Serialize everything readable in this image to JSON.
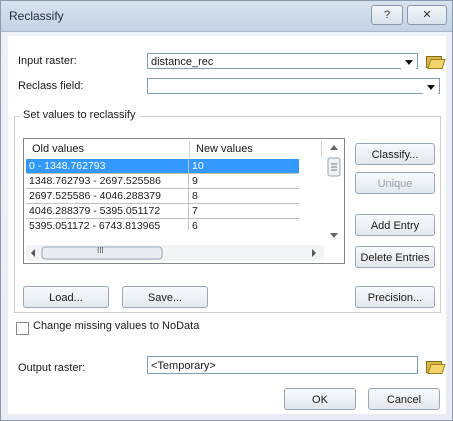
{
  "window": {
    "title": "Reclassify",
    "help_label": "?",
    "close_label": "✕"
  },
  "input_raster": {
    "label": "Input raster:",
    "value": "distance_rec"
  },
  "reclass_field": {
    "label": "Reclass field:",
    "value": ""
  },
  "group": {
    "label": "Set values to reclassify"
  },
  "table": {
    "headers": [
      "Old values",
      "New values"
    ],
    "rows": [
      {
        "old": "0 - 1348.762793",
        "new": "10"
      },
      {
        "old": "1348.762793 - 2697.525586",
        "new": "9"
      },
      {
        "old": "2697.525586 - 4046.288379",
        "new": "8"
      },
      {
        "old": "4046.288379 - 5395.051172",
        "new": "7"
      },
      {
        "old": "5395.051172 - 6743.813965",
        "new": "6"
      }
    ],
    "scroll_grip": "III"
  },
  "buttons": {
    "classify": "Classify...",
    "unique": "Unique",
    "add_entry": "Add Entry",
    "delete_entries": "Delete Entries",
    "load": "Load...",
    "save": "Save...",
    "precision": "Precision...",
    "ok": "OK",
    "cancel": "Cancel"
  },
  "missing_nodata": {
    "label": "Change missing values to NoData",
    "checked": false
  },
  "output_raster": {
    "label": "Output raster:",
    "value": "<Temporary>"
  }
}
